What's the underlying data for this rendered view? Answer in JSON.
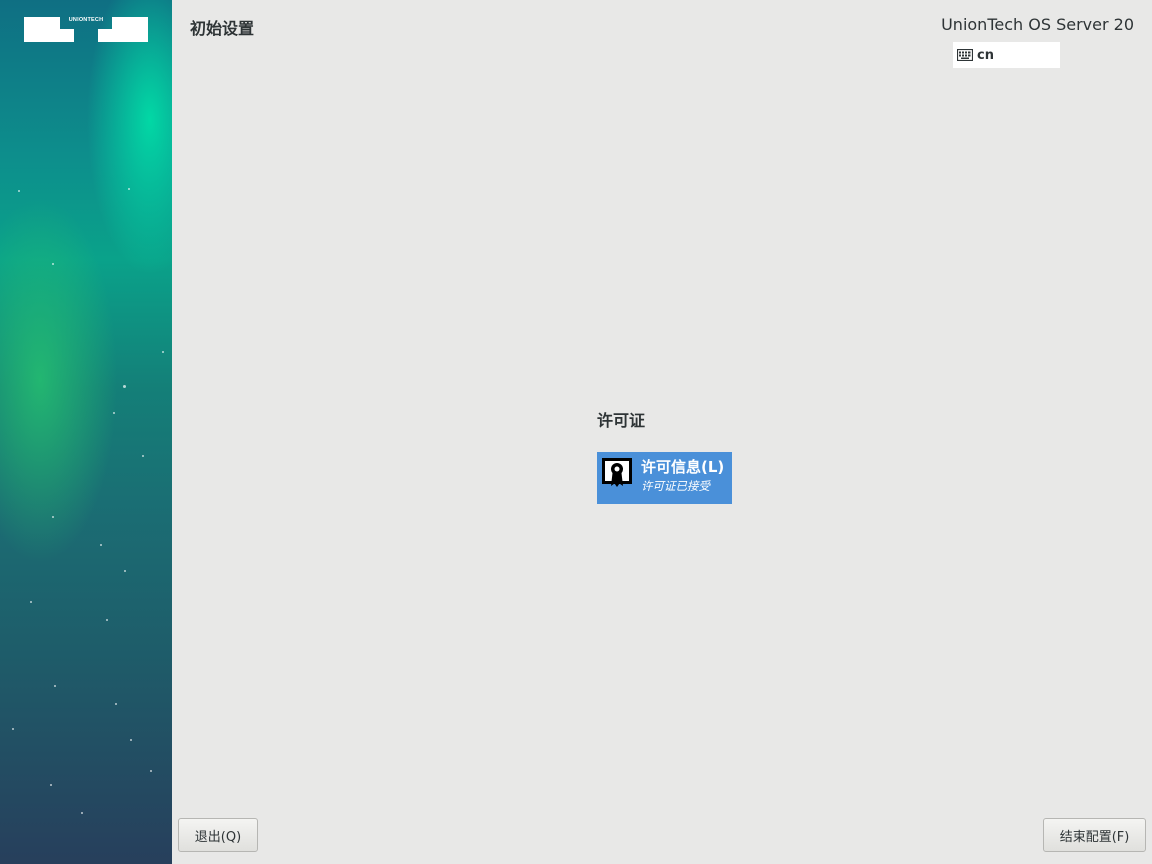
{
  "sidebar": {
    "logo_text": "UNIONTECH"
  },
  "header": {
    "title": "初始设置",
    "product": "UnionTech OS Server 20",
    "keyboard_layout": "cn"
  },
  "main": {
    "section_title": "许可证",
    "spokes": [
      {
        "title": "许可信息(L)",
        "status": "许可证已接受",
        "icon": "license-certificate-icon"
      }
    ]
  },
  "footer": {
    "quit_label": "退出(Q)",
    "finish_label": "结束配置(F)"
  },
  "colors": {
    "spoke_selected": "#4a90d9",
    "background": "#e8e8e7"
  }
}
